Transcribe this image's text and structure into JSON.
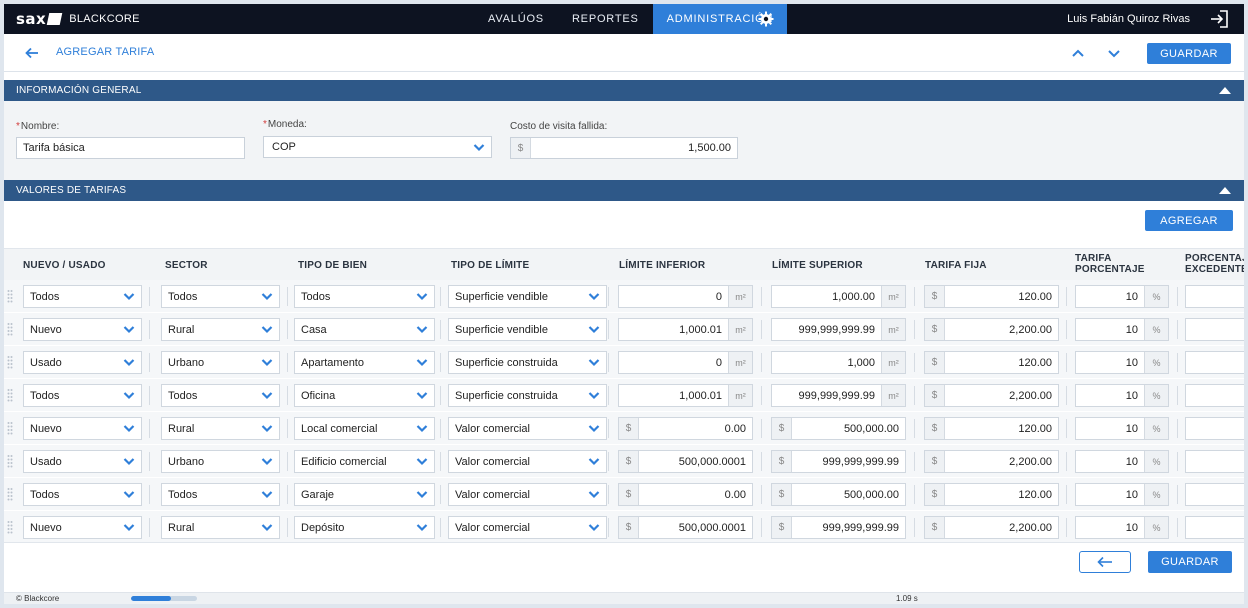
{
  "topnav": {
    "logo": "sax",
    "brand": "BLACKCORE",
    "items": [
      {
        "label": "AVALÚOS",
        "active": false
      },
      {
        "label": "REPORTES",
        "active": false
      },
      {
        "label": "ADMINISTRACIÓN",
        "active": true
      }
    ],
    "user": "Luis Fabián Quiroz Rivas"
  },
  "page": {
    "title": "AGREGAR TARIFA",
    "save_label": "GUARDAR"
  },
  "general": {
    "heading": "INFORMACIÓN GENERAL",
    "nombre_label": "Nombre:",
    "nombre_value": "Tarifa básica",
    "moneda_label": "Moneda:",
    "moneda_value": "COP",
    "costo_label": "Costo de visita fallida:",
    "costo_prefix": "$",
    "costo_value": "1,500.00"
  },
  "valores": {
    "heading": "VALORES DE TARIFAS",
    "add_label": "AGREGAR",
    "columns": [
      "NUEVO / USADO",
      "SECTOR",
      "TIPO DE BIEN",
      "TIPO DE LÍMITE",
      "LÍMITE INFERIOR",
      "LÍMITE SUPERIOR",
      "TARIFA FIJA",
      "TARIFA PORCENTAJE",
      "PORCENTAJE EXCEDENTE"
    ],
    "rows": [
      {
        "estado": "Todos",
        "sector": "Todos",
        "bien": "Todos",
        "limite": "Superficie vendible",
        "inf": "0",
        "inf_unit": "m²",
        "sup": "1,000.00",
        "sup_unit": "m²",
        "fija": "120.00",
        "pct": "10"
      },
      {
        "estado": "Nuevo",
        "sector": "Rural",
        "bien": "Casa",
        "limite": "Superficie vendible",
        "inf": "1,000.01",
        "inf_unit": "m²",
        "sup": "999,999,999.99",
        "sup_unit": "m²",
        "fija": "2,200.00",
        "pct": "10"
      },
      {
        "estado": "Usado",
        "sector": "Urbano",
        "bien": "Apartamento",
        "limite": "Superficie construida",
        "inf": "0",
        "inf_unit": "m²",
        "sup": "1,000",
        "sup_unit": "m²",
        "fija": "120.00",
        "pct": "10"
      },
      {
        "estado": "Todos",
        "sector": "Todos",
        "bien": "Oficina",
        "limite": "Superficie construida",
        "inf": "1,000.01",
        "inf_unit": "m²",
        "sup": "999,999,999.99",
        "sup_unit": "m²",
        "fija": "2,200.00",
        "pct": "10"
      },
      {
        "estado": "Nuevo",
        "sector": "Rural",
        "bien": "Local comercial",
        "limite": "Valor comercial",
        "inf": "0.00",
        "inf_unit": "$",
        "sup": "500,000.00",
        "sup_unit": "$",
        "fija": "120.00",
        "pct": "10"
      },
      {
        "estado": "Usado",
        "sector": "Urbano",
        "bien": "Edificio comercial",
        "limite": "Valor comercial",
        "inf": "500,000.0001",
        "inf_unit": "$",
        "sup": "999,999,999.99",
        "sup_unit": "$",
        "fija": "2,200.00",
        "pct": "10"
      },
      {
        "estado": "Todos",
        "sector": "Todos",
        "bien": "Garaje",
        "limite": "Valor comercial",
        "inf": "0.00",
        "inf_unit": "$",
        "sup": "500,000.00",
        "sup_unit": "$",
        "fija": "120.00",
        "pct": "10"
      },
      {
        "estado": "Nuevo",
        "sector": "Rural",
        "bien": "Depósito",
        "limite": "Valor comercial",
        "inf": "500,000.0001",
        "inf_unit": "$",
        "sup": "999,999,999.99",
        "sup_unit": "$",
        "fija": "2,200.00",
        "pct": "10"
      }
    ],
    "currency_symbol": "$",
    "pct_symbol": "%"
  },
  "footer": {
    "save_label": "GUARDAR"
  },
  "status": {
    "copyright": "© Blackcore",
    "progress": 0.6,
    "time": "1.09 s"
  },
  "colors": {
    "accent": "#2f7fd9",
    "section": "#2e5888",
    "nav": "#0d1321"
  }
}
